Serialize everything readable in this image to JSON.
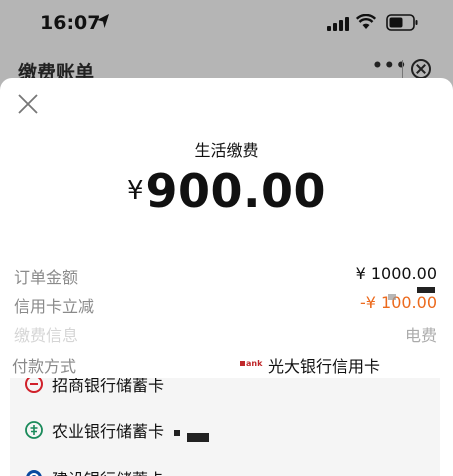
{
  "status_bar": {
    "time": "16:07"
  },
  "background_page": {
    "title": "缴费账单",
    "more": "•••"
  },
  "sheet": {
    "service_name": "生活缴费",
    "currency_symbol": "¥",
    "amount": "900.00",
    "rows": [
      {
        "label": "订单金额",
        "value": "¥ 1000.00"
      },
      {
        "label": "信用卡立减",
        "value": "-¥ 100.00"
      },
      {
        "label": "缴费信息",
        "value": "电费"
      }
    ],
    "payment": {
      "label": "付款方式",
      "bank_logo_text": "ank",
      "selected": "光大银行信用卡"
    },
    "options": [
      {
        "label": "招商银行储蓄卡",
        "icon": "cmb-bank-icon"
      },
      {
        "label": "农业银行储蓄卡",
        "icon": "abc-bank-icon"
      },
      {
        "label": "建设银行储蓄卡",
        "icon": "ccb-bank-icon"
      }
    ]
  },
  "colors": {
    "discount": "#ec6a1d",
    "label_gray": "#8a8a8a",
    "cmb_red": "#d0202a",
    "abc_green": "#1a8a5a",
    "ccb_blue": "#0a4aa0"
  }
}
